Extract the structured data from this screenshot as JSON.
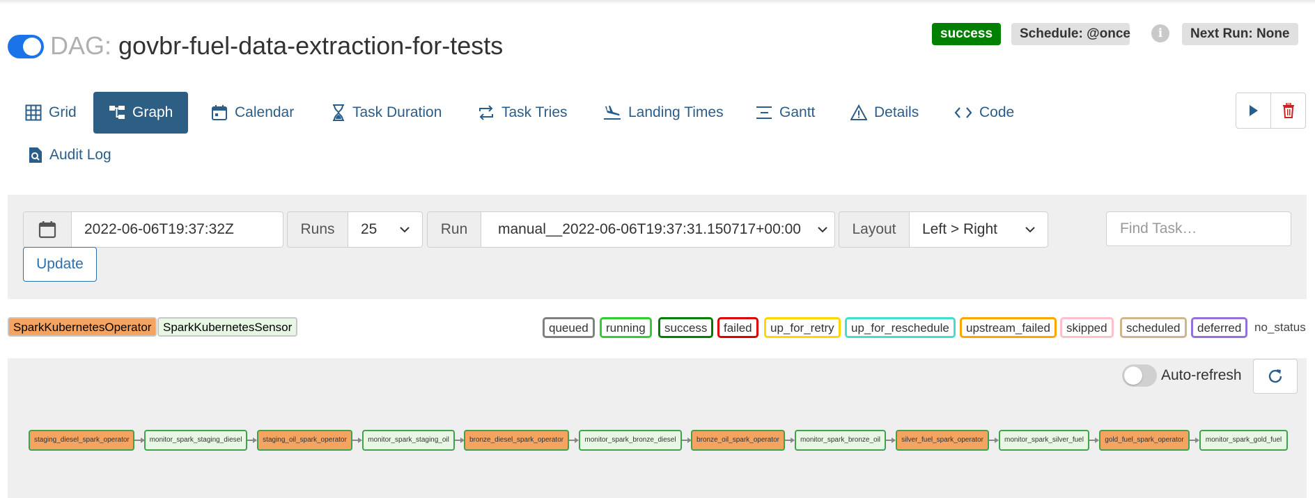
{
  "header": {
    "dag_prefix": "DAG:",
    "dag_id": "govbr-fuel-data-extraction-for-tests",
    "status_badge": "success",
    "schedule": "Schedule: @once",
    "info_icon": "i",
    "next_run": "Next Run: None",
    "colors": {
      "toggle": "#1a73e8",
      "success": "#008000"
    }
  },
  "tabs": [
    {
      "label": "Grid",
      "icon": "grid-icon"
    },
    {
      "label": "Graph",
      "icon": "graph-icon",
      "active": true
    },
    {
      "label": "Calendar",
      "icon": "calendar-icon"
    },
    {
      "label": "Task Duration",
      "icon": "hourglass-icon"
    },
    {
      "label": "Task Tries",
      "icon": "retry-arrows-icon"
    },
    {
      "label": "Landing Times",
      "icon": "plane-landing-icon"
    },
    {
      "label": "Gantt",
      "icon": "gantt-icon"
    },
    {
      "label": "Details",
      "icon": "warning-triangle-icon"
    },
    {
      "label": "Code",
      "icon": "code-icon"
    },
    {
      "label": "Audit Log",
      "icon": "file-search-icon"
    }
  ],
  "controls": {
    "base_date": "2022-06-06T19:37:32Z",
    "runs_label": "Runs",
    "runs_value": "25",
    "run_label": "Run",
    "run_value": "manual__2022-06-06T19:37:31.150717+00:00",
    "layout_label": "Layout",
    "layout_value": "Left > Right",
    "find_placeholder": "Find Task…",
    "update_label": "Update"
  },
  "operators": [
    {
      "label": "SparkKubernetesOperator",
      "color": "#f4a460"
    },
    {
      "label": "SparkKubernetesSensor",
      "color": "#e8f7e4"
    }
  ],
  "states": [
    {
      "label": "queued",
      "color": "#808080"
    },
    {
      "label": "running",
      "color": "#32cd32"
    },
    {
      "label": "success",
      "color": "#008000"
    },
    {
      "label": "failed",
      "color": "#dd0000"
    },
    {
      "label": "up_for_retry",
      "color": "#ffd700"
    },
    {
      "label": "up_for_reschedule",
      "color": "#40e0d0"
    },
    {
      "label": "upstream_failed",
      "color": "#ffa500"
    },
    {
      "label": "skipped",
      "color": "#ffc0cb"
    },
    {
      "label": "scheduled",
      "color": "#d2b48c"
    },
    {
      "label": "deferred",
      "color": "#9370db"
    }
  ],
  "no_status_label": "no_status",
  "graph": {
    "auto_refresh_label": "Auto-refresh",
    "nodes": [
      {
        "label": "staging_diesel_spark_operator",
        "kind": "operator"
      },
      {
        "label": "monitor_spark_staging_diesel",
        "kind": "sensor"
      },
      {
        "label": "staging_oil_spark_operator",
        "kind": "operator"
      },
      {
        "label": "monitor_spark_staging_oil",
        "kind": "sensor"
      },
      {
        "label": "bronze_diesel_spark_operator",
        "kind": "operator"
      },
      {
        "label": "monitor_spark_bronze_diesel",
        "kind": "sensor"
      },
      {
        "label": "bronze_oil_spark_operator",
        "kind": "operator"
      },
      {
        "label": "monitor_spark_bronze_oil",
        "kind": "sensor"
      },
      {
        "label": "silver_fuel_spark_operator",
        "kind": "operator"
      },
      {
        "label": "monitor_spark_silver_fuel",
        "kind": "sensor"
      },
      {
        "label": "gold_fuel_spark_operator",
        "kind": "operator"
      },
      {
        "label": "monitor_spark_gold_fuel",
        "kind": "sensor"
      }
    ]
  }
}
